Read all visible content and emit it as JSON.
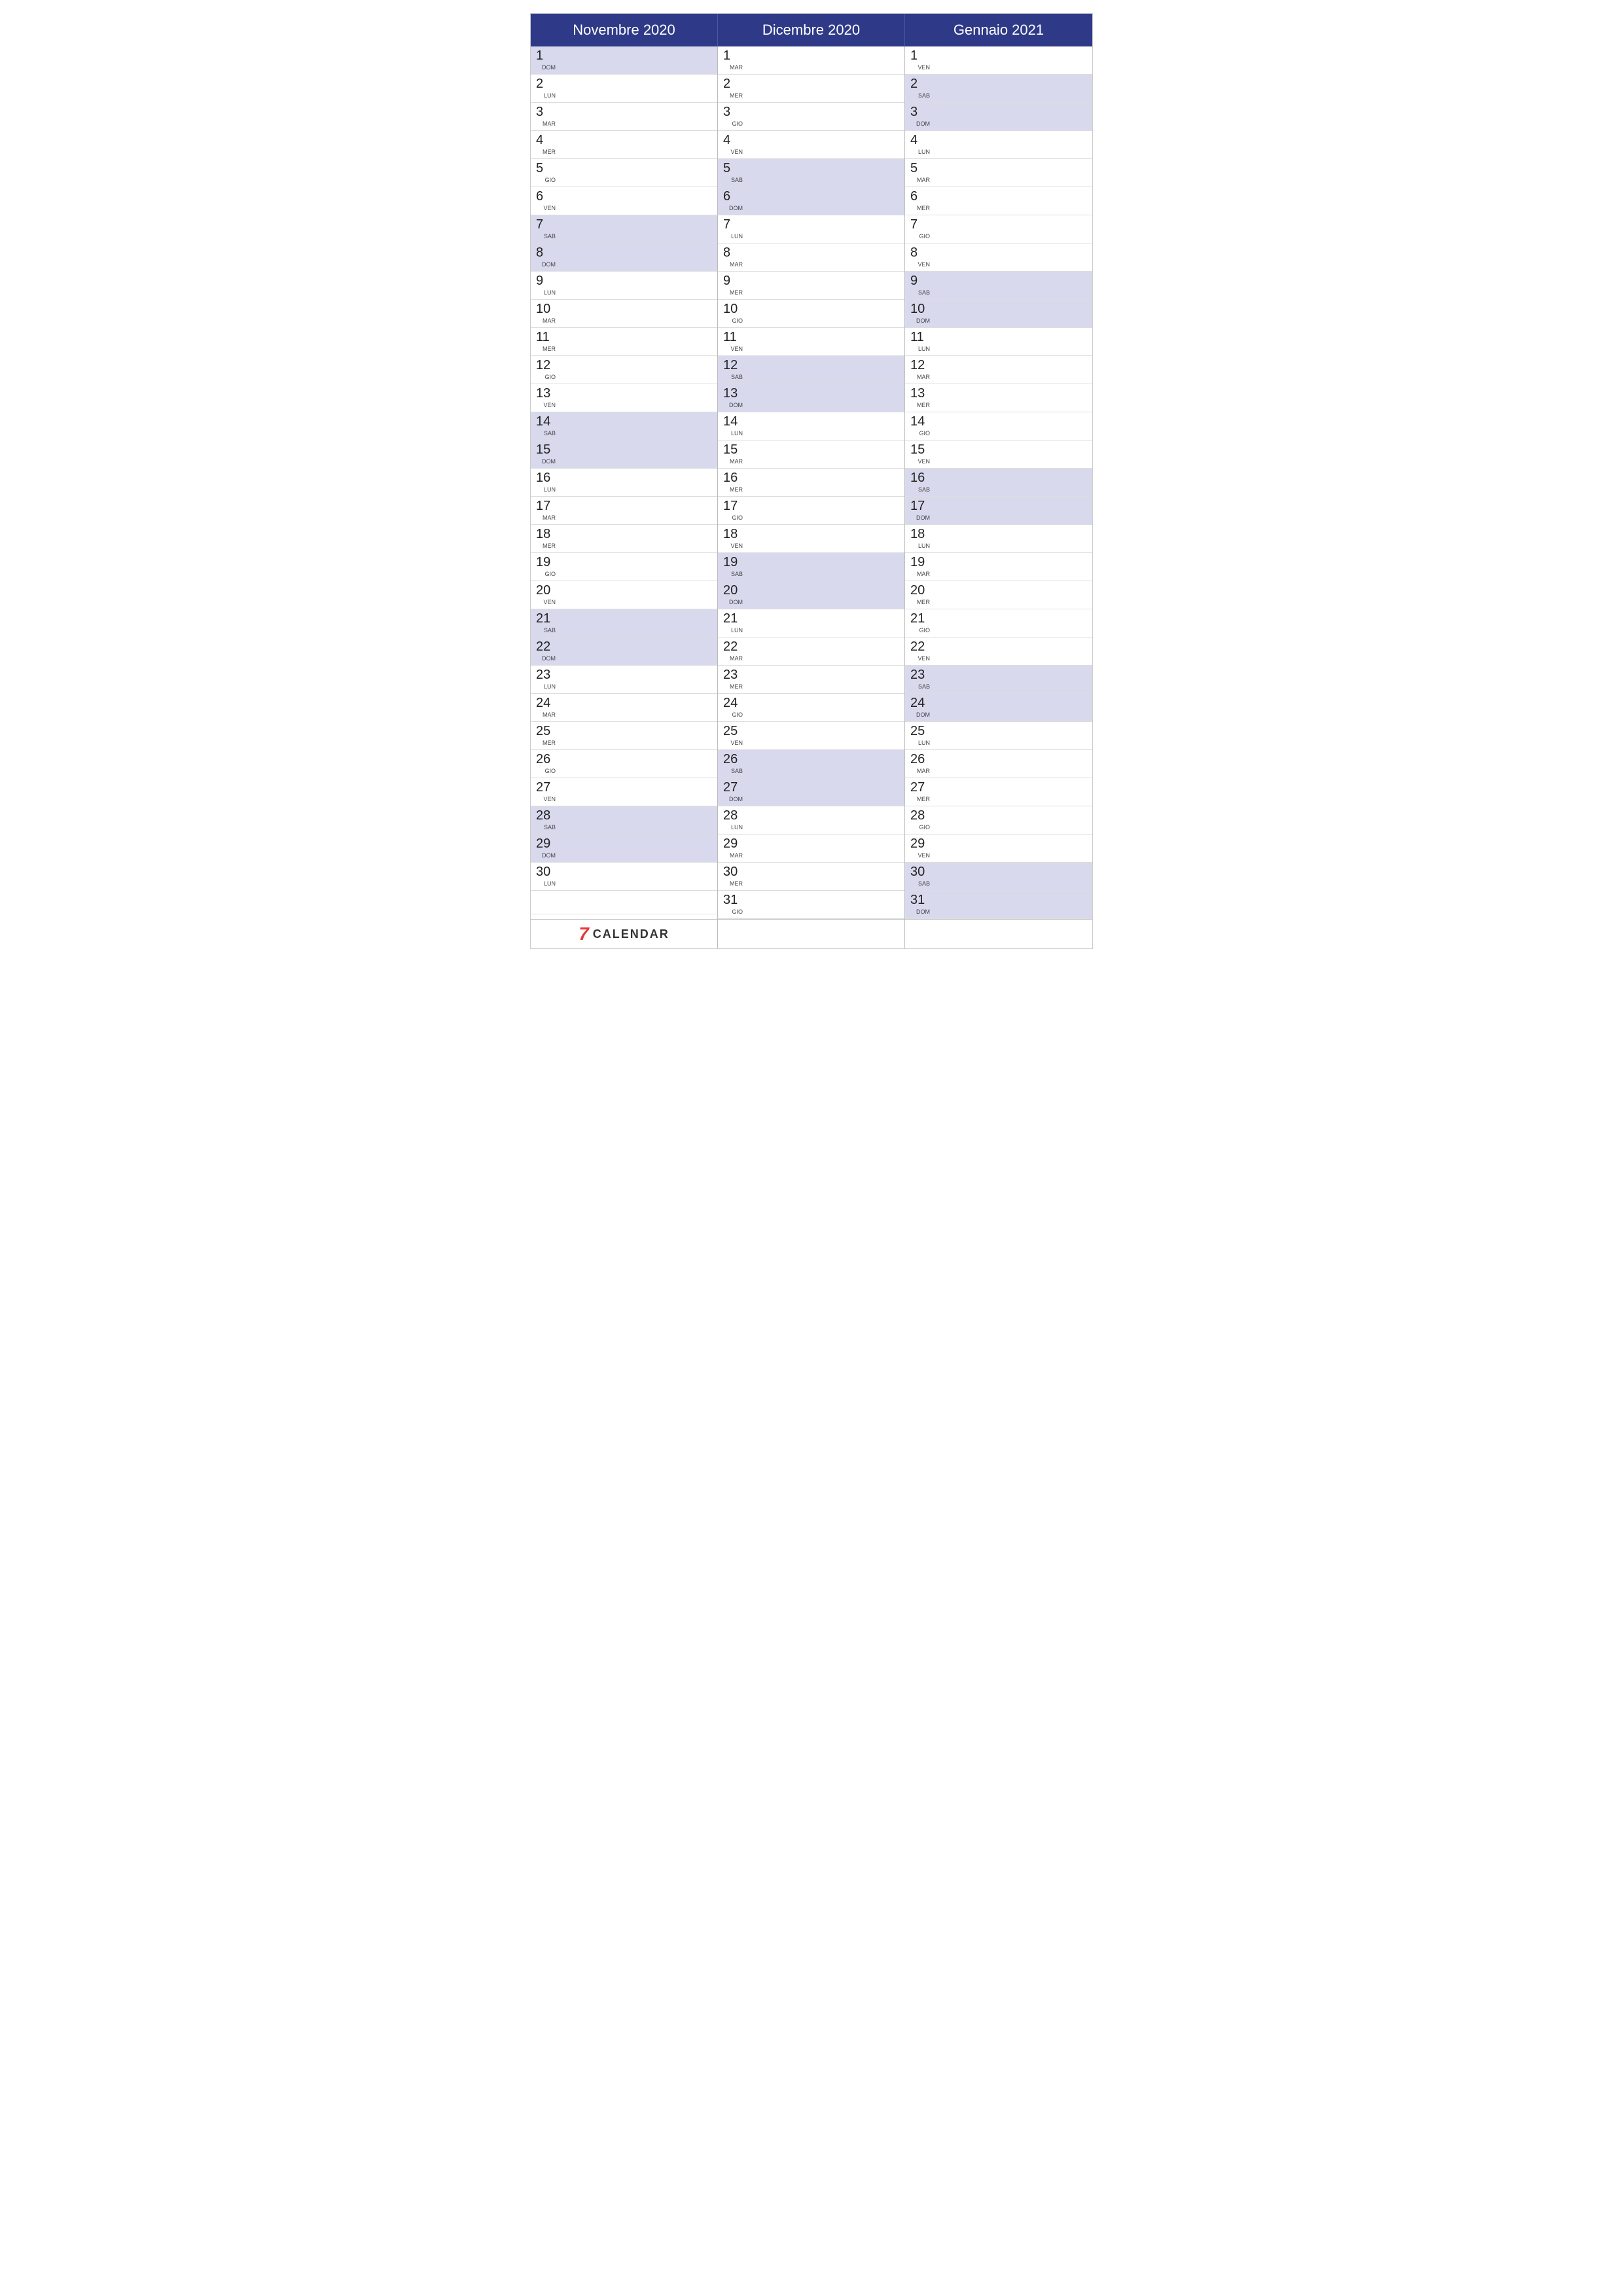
{
  "months": [
    {
      "name": "Novembre 2020",
      "days": [
        {
          "n": "1",
          "d": "DOM",
          "weekend": true
        },
        {
          "n": "2",
          "d": "LUN",
          "weekend": false
        },
        {
          "n": "3",
          "d": "MAR",
          "weekend": false
        },
        {
          "n": "4",
          "d": "MER",
          "weekend": false
        },
        {
          "n": "5",
          "d": "GIO",
          "weekend": false
        },
        {
          "n": "6",
          "d": "VEN",
          "weekend": false
        },
        {
          "n": "7",
          "d": "SAB",
          "weekend": true
        },
        {
          "n": "8",
          "d": "DOM",
          "weekend": true
        },
        {
          "n": "9",
          "d": "LUN",
          "weekend": false
        },
        {
          "n": "10",
          "d": "MAR",
          "weekend": false
        },
        {
          "n": "11",
          "d": "MER",
          "weekend": false
        },
        {
          "n": "12",
          "d": "GIO",
          "weekend": false
        },
        {
          "n": "13",
          "d": "VEN",
          "weekend": false
        },
        {
          "n": "14",
          "d": "SAB",
          "weekend": true
        },
        {
          "n": "15",
          "d": "DOM",
          "weekend": true
        },
        {
          "n": "16",
          "d": "LUN",
          "weekend": false
        },
        {
          "n": "17",
          "d": "MAR",
          "weekend": false
        },
        {
          "n": "18",
          "d": "MER",
          "weekend": false
        },
        {
          "n": "19",
          "d": "GIO",
          "weekend": false
        },
        {
          "n": "20",
          "d": "VEN",
          "weekend": false
        },
        {
          "n": "21",
          "d": "SAB",
          "weekend": true
        },
        {
          "n": "22",
          "d": "DOM",
          "weekend": true
        },
        {
          "n": "23",
          "d": "LUN",
          "weekend": false
        },
        {
          "n": "24",
          "d": "MAR",
          "weekend": false
        },
        {
          "n": "25",
          "d": "MER",
          "weekend": false
        },
        {
          "n": "26",
          "d": "GIO",
          "weekend": false
        },
        {
          "n": "27",
          "d": "VEN",
          "weekend": false
        },
        {
          "n": "28",
          "d": "SAB",
          "weekend": true
        },
        {
          "n": "29",
          "d": "DOM",
          "weekend": true
        },
        {
          "n": "30",
          "d": "LUN",
          "weekend": false
        },
        null
      ],
      "footer": "logo"
    },
    {
      "name": "Dicembre 2020",
      "days": [
        {
          "n": "1",
          "d": "MAR",
          "weekend": false
        },
        {
          "n": "2",
          "d": "MER",
          "weekend": false
        },
        {
          "n": "3",
          "d": "GIO",
          "weekend": false
        },
        {
          "n": "4",
          "d": "VEN",
          "weekend": false
        },
        {
          "n": "5",
          "d": "SAB",
          "weekend": true
        },
        {
          "n": "6",
          "d": "DOM",
          "weekend": true
        },
        {
          "n": "7",
          "d": "LUN",
          "weekend": false
        },
        {
          "n": "8",
          "d": "MAR",
          "weekend": false
        },
        {
          "n": "9",
          "d": "MER",
          "weekend": false
        },
        {
          "n": "10",
          "d": "GIO",
          "weekend": false
        },
        {
          "n": "11",
          "d": "VEN",
          "weekend": false
        },
        {
          "n": "12",
          "d": "SAB",
          "weekend": true
        },
        {
          "n": "13",
          "d": "DOM",
          "weekend": true
        },
        {
          "n": "14",
          "d": "LUN",
          "weekend": false
        },
        {
          "n": "15",
          "d": "MAR",
          "weekend": false
        },
        {
          "n": "16",
          "d": "MER",
          "weekend": false
        },
        {
          "n": "17",
          "d": "GIO",
          "weekend": false
        },
        {
          "n": "18",
          "d": "VEN",
          "weekend": false
        },
        {
          "n": "19",
          "d": "SAB",
          "weekend": true
        },
        {
          "n": "20",
          "d": "DOM",
          "weekend": true
        },
        {
          "n": "21",
          "d": "LUN",
          "weekend": false
        },
        {
          "n": "22",
          "d": "MAR",
          "weekend": false
        },
        {
          "n": "23",
          "d": "MER",
          "weekend": false
        },
        {
          "n": "24",
          "d": "GIO",
          "weekend": false
        },
        {
          "n": "25",
          "d": "VEN",
          "weekend": false
        },
        {
          "n": "26",
          "d": "SAB",
          "weekend": true
        },
        {
          "n": "27",
          "d": "DOM",
          "weekend": true
        },
        {
          "n": "28",
          "d": "LUN",
          "weekend": false
        },
        {
          "n": "29",
          "d": "MAR",
          "weekend": false
        },
        {
          "n": "30",
          "d": "MER",
          "weekend": false
        },
        {
          "n": "31",
          "d": "GIO",
          "weekend": false
        }
      ],
      "footer": "empty"
    },
    {
      "name": "Gennaio 2021",
      "days": [
        {
          "n": "1",
          "d": "VEN",
          "weekend": false
        },
        {
          "n": "2",
          "d": "SAB",
          "weekend": true
        },
        {
          "n": "3",
          "d": "DOM",
          "weekend": true
        },
        {
          "n": "4",
          "d": "LUN",
          "weekend": false
        },
        {
          "n": "5",
          "d": "MAR",
          "weekend": false
        },
        {
          "n": "6",
          "d": "MER",
          "weekend": false
        },
        {
          "n": "7",
          "d": "GIO",
          "weekend": false
        },
        {
          "n": "8",
          "d": "VEN",
          "weekend": false
        },
        {
          "n": "9",
          "d": "SAB",
          "weekend": true
        },
        {
          "n": "10",
          "d": "DOM",
          "weekend": true
        },
        {
          "n": "11",
          "d": "LUN",
          "weekend": false
        },
        {
          "n": "12",
          "d": "MAR",
          "weekend": false
        },
        {
          "n": "13",
          "d": "MER",
          "weekend": false
        },
        {
          "n": "14",
          "d": "GIO",
          "weekend": false
        },
        {
          "n": "15",
          "d": "VEN",
          "weekend": false
        },
        {
          "n": "16",
          "d": "SAB",
          "weekend": true
        },
        {
          "n": "17",
          "d": "DOM",
          "weekend": true
        },
        {
          "n": "18",
          "d": "LUN",
          "weekend": false
        },
        {
          "n": "19",
          "d": "MAR",
          "weekend": false
        },
        {
          "n": "20",
          "d": "MER",
          "weekend": false
        },
        {
          "n": "21",
          "d": "GIO",
          "weekend": false
        },
        {
          "n": "22",
          "d": "VEN",
          "weekend": false
        },
        {
          "n": "23",
          "d": "SAB",
          "weekend": true
        },
        {
          "n": "24",
          "d": "DOM",
          "weekend": true
        },
        {
          "n": "25",
          "d": "LUN",
          "weekend": false
        },
        {
          "n": "26",
          "d": "MAR",
          "weekend": false
        },
        {
          "n": "27",
          "d": "MER",
          "weekend": false
        },
        {
          "n": "28",
          "d": "GIO",
          "weekend": false
        },
        {
          "n": "29",
          "d": "VEN",
          "weekend": false
        },
        {
          "n": "30",
          "d": "SAB",
          "weekend": true
        },
        {
          "n": "31",
          "d": "DOM",
          "weekend": true
        }
      ],
      "footer": "empty"
    }
  ],
  "logo": {
    "number": "7",
    "label": "CALENDAR"
  }
}
